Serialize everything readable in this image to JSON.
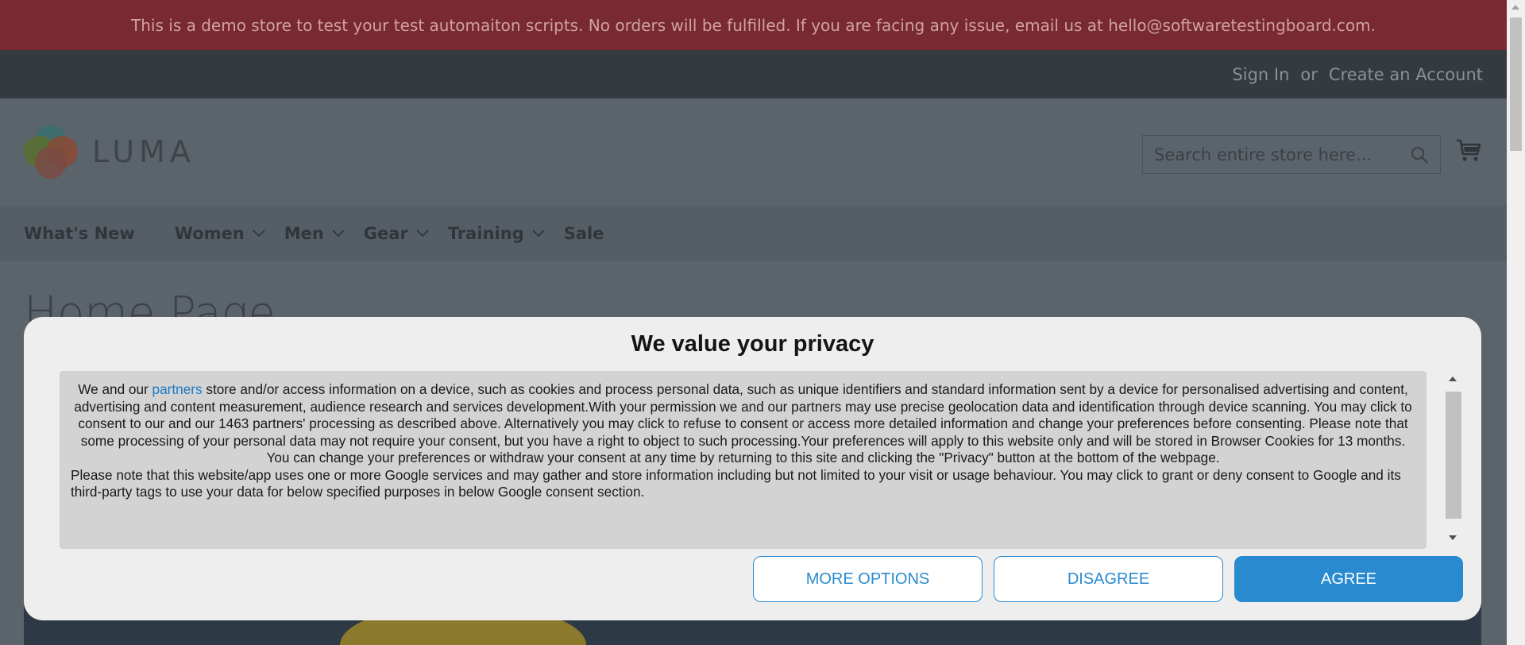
{
  "banner": {
    "text": "This is a demo store to test your test automaiton scripts. No orders will be fulfilled. If you are facing any issue, email us at hello@softwaretestingboard.com."
  },
  "top_links": {
    "sign_in": "Sign In",
    "or": "or",
    "create_account": "Create an Account"
  },
  "header": {
    "logo_text": "LUMA",
    "search_placeholder": "Search entire store here..."
  },
  "nav": {
    "items": [
      {
        "label": "What's New",
        "has_dropdown": false
      },
      {
        "label": "Women",
        "has_dropdown": true
      },
      {
        "label": "Men",
        "has_dropdown": true
      },
      {
        "label": "Gear",
        "has_dropdown": true
      },
      {
        "label": "Training",
        "has_dropdown": true
      },
      {
        "label": "Sale",
        "has_dropdown": false
      }
    ]
  },
  "page": {
    "title": "Home Page"
  },
  "consent": {
    "title": "We value your privacy",
    "para1_before_link": "We and our ",
    "para1_link": "partners",
    "para1_after_link": " store and/or access information on a device, such as cookies and process personal data, such as unique identifiers and standard information sent by a device for personalised advertising and content, advertising and content measurement, audience research and services development.With your permission we and our partners may use precise geolocation data and identification through device scanning. You may click to consent to our and our 1463 partners' processing as described above. Alternatively you may click to refuse to consent or access more detailed information and change your preferences before consenting. Please note that some processing of your personal data may not require your consent, but you have a right to object to such processing.Your preferences will apply to this website only and will be stored in Browser Cookies for 13 months. You can change your preferences or withdraw your consent at any time by returning to this site and clicking the \"Privacy\" button at the bottom of the webpage.",
    "para2": "Please note that this website/app uses one or more Google services and may gather and store information including but not limited to your visit or usage behaviour. You may click to grant or deny consent to Google and its third-party tags to use your data for below specified purposes in below Google consent section.",
    "buttons": {
      "more_options": "MORE OPTIONS",
      "disagree": "DISAGREE",
      "agree": "AGREE"
    }
  },
  "colors": {
    "banner_bg": "#792930",
    "accent": "#2a8ad0",
    "overlay_page": "#5b636b"
  }
}
